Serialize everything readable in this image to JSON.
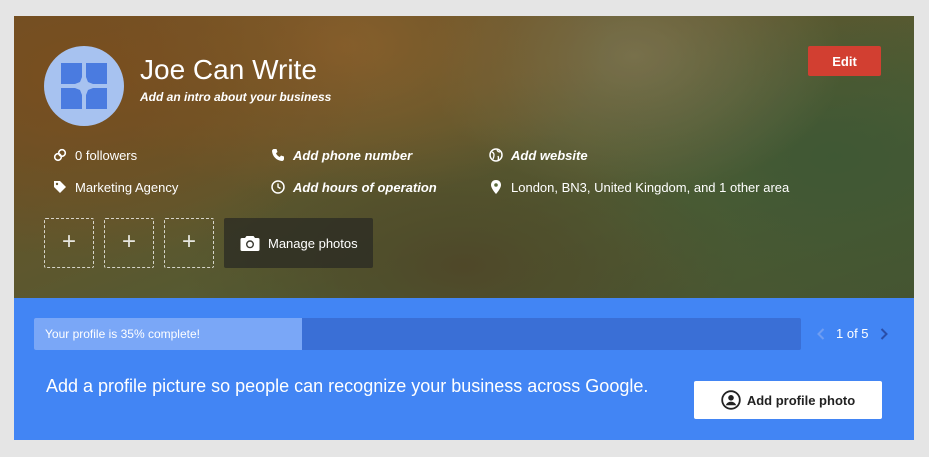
{
  "profile": {
    "name": "Joe Can Write",
    "intro": "Add an intro about your business",
    "edit_label": "Edit"
  },
  "info": {
    "followers": "0 followers",
    "phone": "Add phone number",
    "website": "Add website",
    "category": "Marketing Agency",
    "hours": "Add hours of operation",
    "location": "London, BN3, United Kingdom, and 1 other area"
  },
  "photos": {
    "slot_symbol": "+",
    "manage_label": "Manage photos"
  },
  "completion": {
    "label": "Your profile is 35% complete!",
    "percent": 35,
    "pager": "1 of 5",
    "prompt": "Add a profile picture so people can recognize your business across Google.",
    "add_photo_label": "Add profile photo"
  },
  "colors": {
    "edit_button": "#d23f31",
    "panel": "#4285f4",
    "progress_track": "#3a6fd6",
    "progress_fill": "#7aa7f7",
    "avatar_bg": "#a7c2f0",
    "logo": "#4a7be0"
  },
  "icons": {
    "followers": "link-icon",
    "phone": "phone-icon",
    "website": "globe-icon",
    "category": "tag-icon",
    "hours": "clock-icon",
    "location": "location-pin-icon",
    "manage": "camera-icon",
    "add_photo": "account-circle-icon"
  }
}
